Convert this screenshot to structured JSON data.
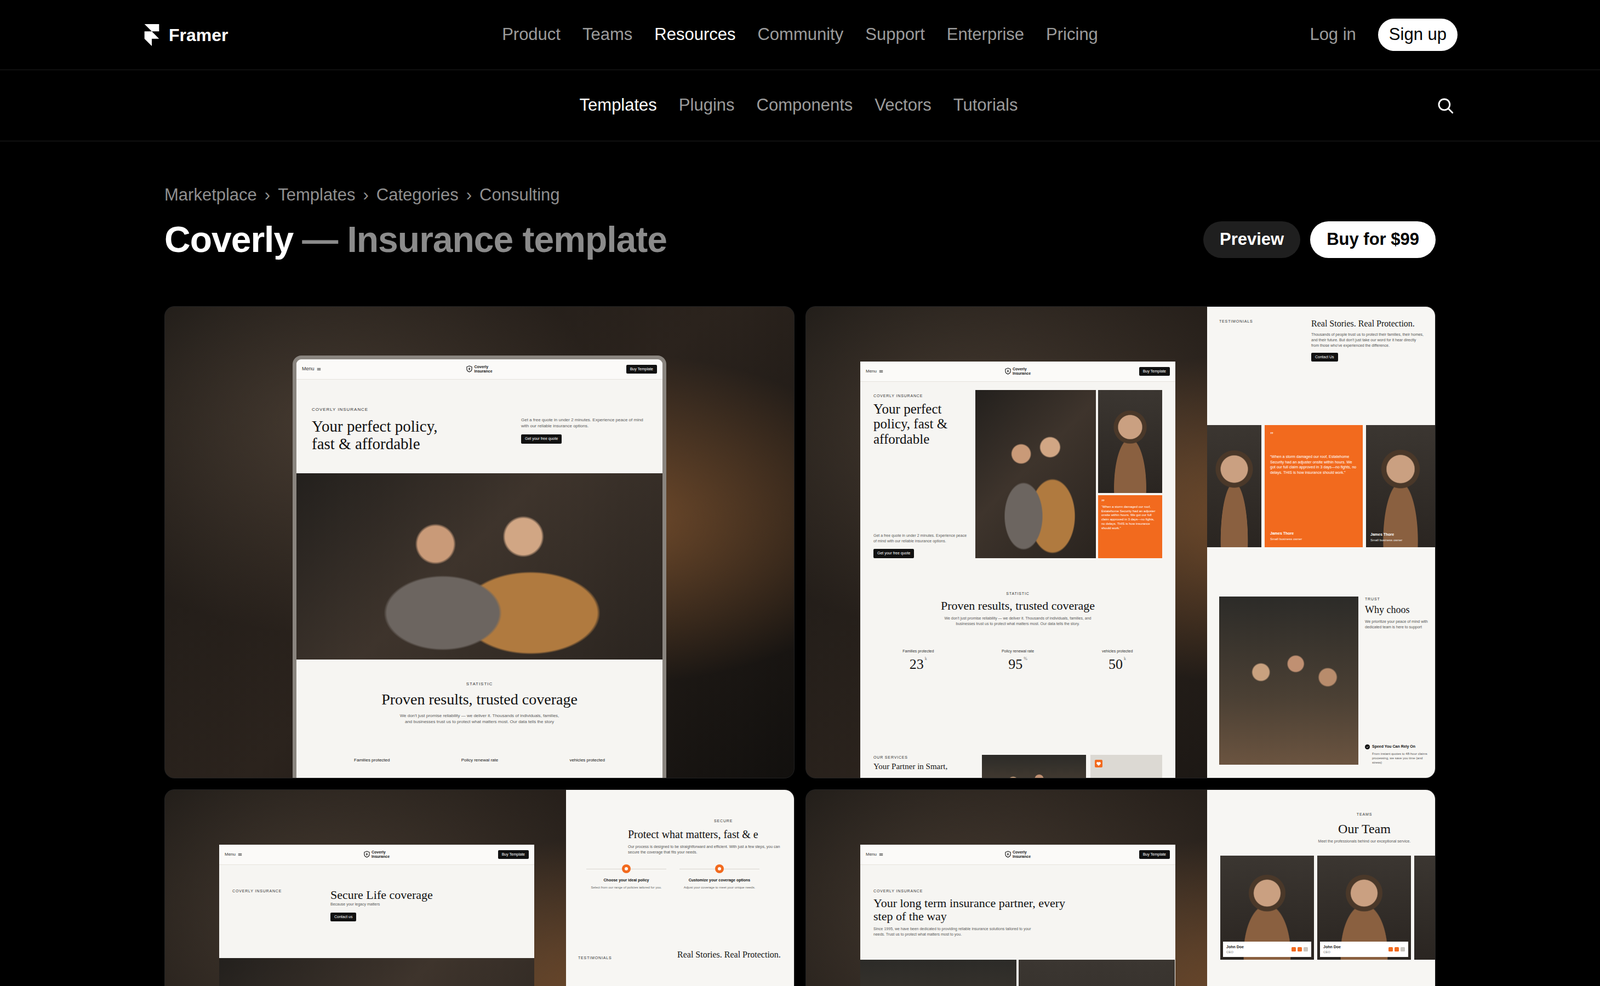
{
  "topnav": {
    "logo": "Framer",
    "items": [
      {
        "label": "Product",
        "selected": false
      },
      {
        "label": "Teams",
        "selected": false
      },
      {
        "label": "Resources",
        "selected": true
      },
      {
        "label": "Community",
        "selected": false
      },
      {
        "label": "Support",
        "selected": false
      },
      {
        "label": "Enterprise",
        "selected": false
      },
      {
        "label": "Pricing",
        "selected": false
      }
    ],
    "login": "Log in",
    "signup": "Sign up"
  },
  "subnav": {
    "items": [
      {
        "label": "Templates",
        "selected": true
      },
      {
        "label": "Plugins",
        "selected": false
      },
      {
        "label": "Components",
        "selected": false
      },
      {
        "label": "Vectors",
        "selected": false
      },
      {
        "label": "Tutorials",
        "selected": false
      }
    ]
  },
  "breadcrumb": [
    {
      "label": "Marketplace",
      "separator": "›"
    },
    {
      "label": "Templates",
      "separator": "›"
    },
    {
      "label": "Categories",
      "separator": "›"
    },
    {
      "label": "Consulting"
    }
  ],
  "title": {
    "name": "Coverly",
    "subtitle": "— Insurance template"
  },
  "actions": {
    "preview": "Preview",
    "buy": "Buy for $99"
  },
  "previews": [
    {
      "kind": "hero",
      "nav": {
        "menu": "Menu",
        "brand_top": "Coverly",
        "brand_bottom": "Insurance",
        "button": "Buy Template"
      },
      "eyebrow": "COVERLY INSURANCE",
      "heading": "Your perfect policy, fast & affordable",
      "intro": "Get a free quote in under 2 minutes. Experience peace of mind with our reliable insurance options.",
      "cta": "Get your free quote",
      "stats": {
        "eyebrow": "STATISTIC",
        "heading": "Proven results, trusted coverage",
        "text": "We don't just promise reliability — we deliver it. Thousands of individuals, families, and businesses trust us to protect what matters most. Our data tells the story",
        "labels": [
          "Families protected",
          "Policy renewal rate",
          "vehicles protected"
        ]
      }
    },
    {
      "kind": "home",
      "nav": {
        "menu": "Menu",
        "brand_top": "Coverly",
        "brand_bottom": "Insurance",
        "button": "Buy Template"
      },
      "eyebrow": "COVERLY INSURANCE",
      "heading": "Your perfect policy, fast & affordable",
      "intro": "Get a free quote in under 2 minutes. Experience peace of mind with our reliable insurance options.",
      "cta": "Get your free quote",
      "quote": {
        "mark": "”",
        "text": "“When a storm damaged our roof, Estatehome Security had an adjuster onsite within hours. We got our full claim approved in 3 days—no fights, no delays. THIS is how insurance should work.”"
      },
      "stats": {
        "eyebrow": "STATISTIC",
        "heading": "Proven results, trusted coverage",
        "text": "We don't just promise reliability — we deliver it. Thousands of individuals, families, and businesses trust us to protect what matters most. Our data tells the story.",
        "items": [
          {
            "label": "Families protected",
            "value": "23",
            "unit": "k"
          },
          {
            "label": "Policy renewal rate",
            "value": "95",
            "unit": "%"
          },
          {
            "label": "vehicles protected",
            "value": "50",
            "unit": "k"
          }
        ]
      },
      "services": {
        "eyebrow": "OUR SERVICES",
        "heading": "Your Partner in Smart,"
      },
      "side": {
        "eyebrow": "TESTIMONIALS",
        "heading": "Real Stories. Real Protection.",
        "text": "Thousands of people trust us to protect their families, their homes, and their future. But don't just take our word for it hear directly from those who've experienced the difference.",
        "cta": "Contact Us",
        "quote": {
          "mark": "”",
          "text": "“When a storm damaged our roof, Estatehome Security had an adjuster onsite within hours. We got our full claim approved in 3 days—no fights, no delays. THIS is how insurance should work.”",
          "author": "James Thore",
          "role": "Small business owner"
        },
        "person": {
          "author": "James Thore",
          "role": "Small business owner"
        },
        "trust": {
          "eyebrow": "TRUST",
          "heading": "Why choos",
          "text": "We prioritize your peace of mind with dedicated team is here to support",
          "point": "Speed You Can Rely On",
          "point_text": "From instant quotes to 48-hour claims processing, we save you time (and stress)"
        }
      }
    },
    {
      "kind": "life",
      "nav": {
        "menu": "Menu",
        "brand_top": "Coverly",
        "brand_bottom": "Insurance",
        "button": "Buy Template"
      },
      "eyebrow": "COVERLY INSURANCE",
      "heading": "Secure Life coverage",
      "sub": "Because your legacy matters",
      "cta": "Contact us",
      "side": {
        "eyebrow": "SECURE",
        "heading": "Protect what matters, fast & e",
        "text": "Our process is designed to be straightforward and efficient. With just a few steps, you can secure the coverage that fits your needs.",
        "steps": [
          {
            "title": "Choose your ideal policy",
            "text": "Select from our range of policies tailored for you."
          },
          {
            "title": "Customize your coverage options",
            "text": "Adjust your coverage to meet your unique needs."
          }
        ],
        "eyebrow2": "TESTIMONIALS",
        "heading2": "Real Stories. Real Protection."
      }
    },
    {
      "kind": "about",
      "nav": {
        "menu": "Menu",
        "brand_top": "Coverly",
        "brand_bottom": "Insurance",
        "button": "Buy Template"
      },
      "eyebrow": "COVERLY INSURANCE",
      "heading": "Your long term insurance partner, every step of the way",
      "text": "Since 1995, we have been dedicated to providing reliable insurance solutions tailored to your needs. Trust us to protect what matters most to you.",
      "side": {
        "eyebrow": "TEAMS",
        "heading": "Our Team",
        "text": "Meet the professionals behind our exceptional service.",
        "members": [
          {
            "name": "John Doe",
            "role": "CEO"
          },
          {
            "name": "John Doe",
            "role": "CEO"
          }
        ]
      }
    }
  ]
}
